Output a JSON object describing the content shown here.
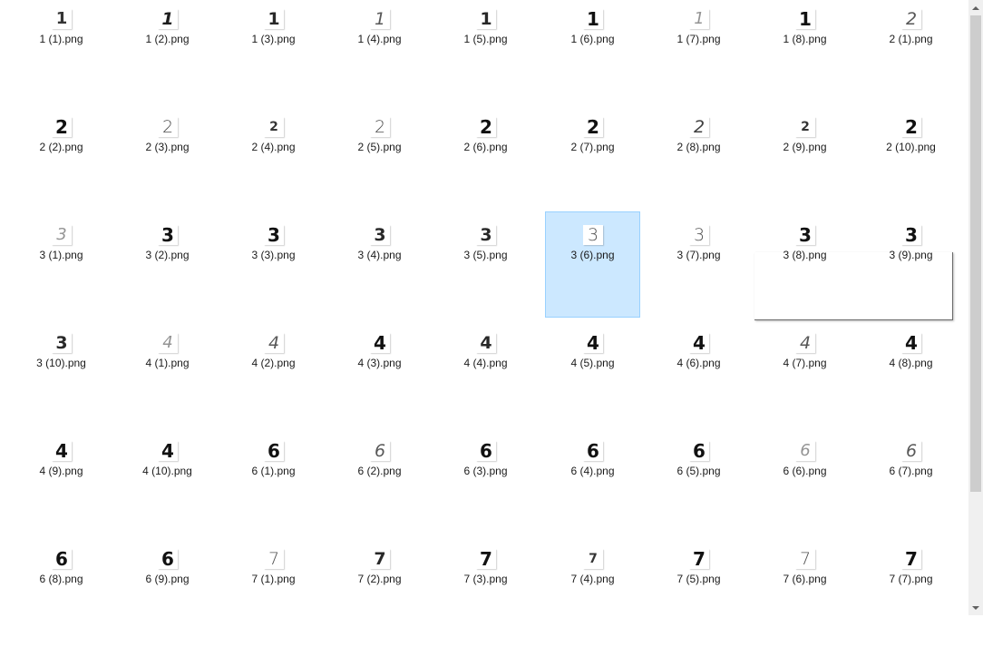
{
  "files": [
    {
      "name": "1 (1).png",
      "digit": "1",
      "style": "bold-smear",
      "selected": false
    },
    {
      "name": "1 (2).png",
      "digit": "1",
      "style": "italic-bold",
      "selected": false
    },
    {
      "name": "1 (3).png",
      "digit": "1",
      "style": "bold",
      "selected": false
    },
    {
      "name": "1 (4).png",
      "digit": "1",
      "style": "thin-italic",
      "selected": false
    },
    {
      "name": "1 (5).png",
      "digit": "1",
      "style": "bold",
      "selected": false
    },
    {
      "name": "1 (6).png",
      "digit": "1",
      "style": "heavy",
      "selected": false
    },
    {
      "name": "1 (7).png",
      "digit": "1",
      "style": "faint",
      "selected": false
    },
    {
      "name": "1 (8).png",
      "digit": "1",
      "style": "heavy",
      "selected": false
    },
    {
      "name": "2 (1).png",
      "digit": "2",
      "style": "thin-italic",
      "selected": false
    },
    {
      "name": "2 (2).png",
      "digit": "2",
      "style": "heavy",
      "selected": false
    },
    {
      "name": "2 (3).png",
      "digit": "2",
      "style": "thin",
      "selected": false
    },
    {
      "name": "2 (4).png",
      "digit": "2",
      "style": "small",
      "selected": false
    },
    {
      "name": "2 (5).png",
      "digit": "2",
      "style": "thin",
      "selected": false
    },
    {
      "name": "2 (6).png",
      "digit": "2",
      "style": "heavy",
      "selected": false
    },
    {
      "name": "2 (7).png",
      "digit": "2",
      "style": "heavy",
      "selected": false
    },
    {
      "name": "2 (8).png",
      "digit": "2",
      "style": "italic",
      "selected": false
    },
    {
      "name": "2 (9).png",
      "digit": "2",
      "style": "small",
      "selected": false
    },
    {
      "name": "2 (10).png",
      "digit": "2",
      "style": "heavy",
      "selected": false
    },
    {
      "name": "3 (1).png",
      "digit": "3",
      "style": "faint",
      "selected": false
    },
    {
      "name": "3 (2).png",
      "digit": "3",
      "style": "heavy",
      "selected": false
    },
    {
      "name": "3 (3).png",
      "digit": "3",
      "style": "heavy",
      "selected": false
    },
    {
      "name": "3 (4).png",
      "digit": "3",
      "style": "bold",
      "selected": false
    },
    {
      "name": "3 (5).png",
      "digit": "3",
      "style": "bold",
      "selected": false
    },
    {
      "name": "3 (6).png",
      "digit": "3",
      "style": "thin",
      "selected": true
    },
    {
      "name": "3 (7).png",
      "digit": "3",
      "style": "thin",
      "selected": false
    },
    {
      "name": "3 (8).png",
      "digit": "3",
      "style": "heavy",
      "selected": false
    },
    {
      "name": "3 (9).png",
      "digit": "3",
      "style": "heavy",
      "selected": false
    },
    {
      "name": "3 (10).png",
      "digit": "3",
      "style": "bold",
      "selected": false
    },
    {
      "name": "4 (1).png",
      "digit": "4",
      "style": "faint",
      "selected": false
    },
    {
      "name": "4 (2).png",
      "digit": "4",
      "style": "thin-italic",
      "selected": false
    },
    {
      "name": "4 (3).png",
      "digit": "4",
      "style": "heavy",
      "selected": false
    },
    {
      "name": "4 (4).png",
      "digit": "4",
      "style": "bold",
      "selected": false
    },
    {
      "name": "4 (5).png",
      "digit": "4",
      "style": "heavy",
      "selected": false
    },
    {
      "name": "4 (6).png",
      "digit": "4",
      "style": "heavy",
      "selected": false
    },
    {
      "name": "4 (7).png",
      "digit": "4",
      "style": "thin-italic",
      "selected": false
    },
    {
      "name": "4 (8).png",
      "digit": "4",
      "style": "heavy",
      "selected": false
    },
    {
      "name": "4 (9).png",
      "digit": "4",
      "style": "heavy",
      "selected": false
    },
    {
      "name": "4 (10).png",
      "digit": "4",
      "style": "heavy",
      "selected": false
    },
    {
      "name": "6 (1).png",
      "digit": "6",
      "style": "heavy",
      "selected": false
    },
    {
      "name": "6 (2).png",
      "digit": "6",
      "style": "thin-italic",
      "selected": false
    },
    {
      "name": "6 (3).png",
      "digit": "6",
      "style": "heavy",
      "selected": false
    },
    {
      "name": "6 (4).png",
      "digit": "6",
      "style": "heavy",
      "selected": false
    },
    {
      "name": "6 (5).png",
      "digit": "6",
      "style": "heavy",
      "selected": false
    },
    {
      "name": "6 (6).png",
      "digit": "6",
      "style": "faint",
      "selected": false
    },
    {
      "name": "6 (7).png",
      "digit": "6",
      "style": "thin-italic",
      "selected": false
    },
    {
      "name": "6 (8).png",
      "digit": "6",
      "style": "heavy",
      "selected": false
    },
    {
      "name": "6 (9).png",
      "digit": "6",
      "style": "heavy",
      "selected": false
    },
    {
      "name": "7 (1).png",
      "digit": "7",
      "style": "thin",
      "selected": false
    },
    {
      "name": "7 (2).png",
      "digit": "7",
      "style": "bold",
      "selected": false
    },
    {
      "name": "7 (3).png",
      "digit": "7",
      "style": "heavy",
      "selected": false
    },
    {
      "name": "7 (4).png",
      "digit": "7",
      "style": "small",
      "selected": false
    },
    {
      "name": "7 (5).png",
      "digit": "7",
      "style": "heavy",
      "selected": false
    },
    {
      "name": "7 (6).png",
      "digit": "7",
      "style": "thin",
      "selected": false
    },
    {
      "name": "7 (7).png",
      "digit": "7",
      "style": "heavy",
      "selected": false
    }
  ],
  "colors": {
    "selection_fill": "#cce8ff",
    "selection_border": "#99d1ff",
    "label_text": "#1a1a1a",
    "scrollbar_track": "#f0f0f0",
    "scrollbar_thumb": "#cdcdcd"
  },
  "scrollbar": {
    "up_icon": "scroll-up-arrow-icon",
    "down_icon": "scroll-down-arrow-icon"
  }
}
